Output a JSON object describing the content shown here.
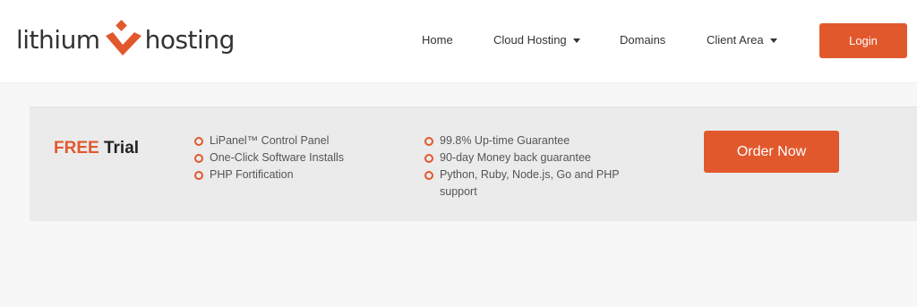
{
  "logo": {
    "left_word": "lithium",
    "right_word": "hosting"
  },
  "nav": {
    "items": [
      {
        "label": "Home",
        "dropdown": false
      },
      {
        "label": "Cloud Hosting",
        "dropdown": true
      },
      {
        "label": "Domains",
        "dropdown": false
      },
      {
        "label": "Client Area",
        "dropdown": true
      }
    ],
    "login_label": "Login"
  },
  "promo": {
    "free_word": "FREE",
    "trial_word": "Trial",
    "features_left": [
      "LiPanel™ Control Panel",
      "One-Click Software Installs",
      "PHP Fortification"
    ],
    "features_right": [
      "99.8% Up-time Guarantee",
      "90-day Money back guarantee",
      "Python, Ruby, Node.js, Go and PHP support"
    ],
    "order_label": "Order Now"
  },
  "colors": {
    "accent": "#e2582d",
    "panel": "#ebebeb",
    "background": "#f7f7f7",
    "text": "#333333"
  },
  "icons": {
    "logo_mark": "lithium-logo-icon",
    "caret": "caret-down-icon",
    "bullet": "circle-bullet-icon"
  }
}
